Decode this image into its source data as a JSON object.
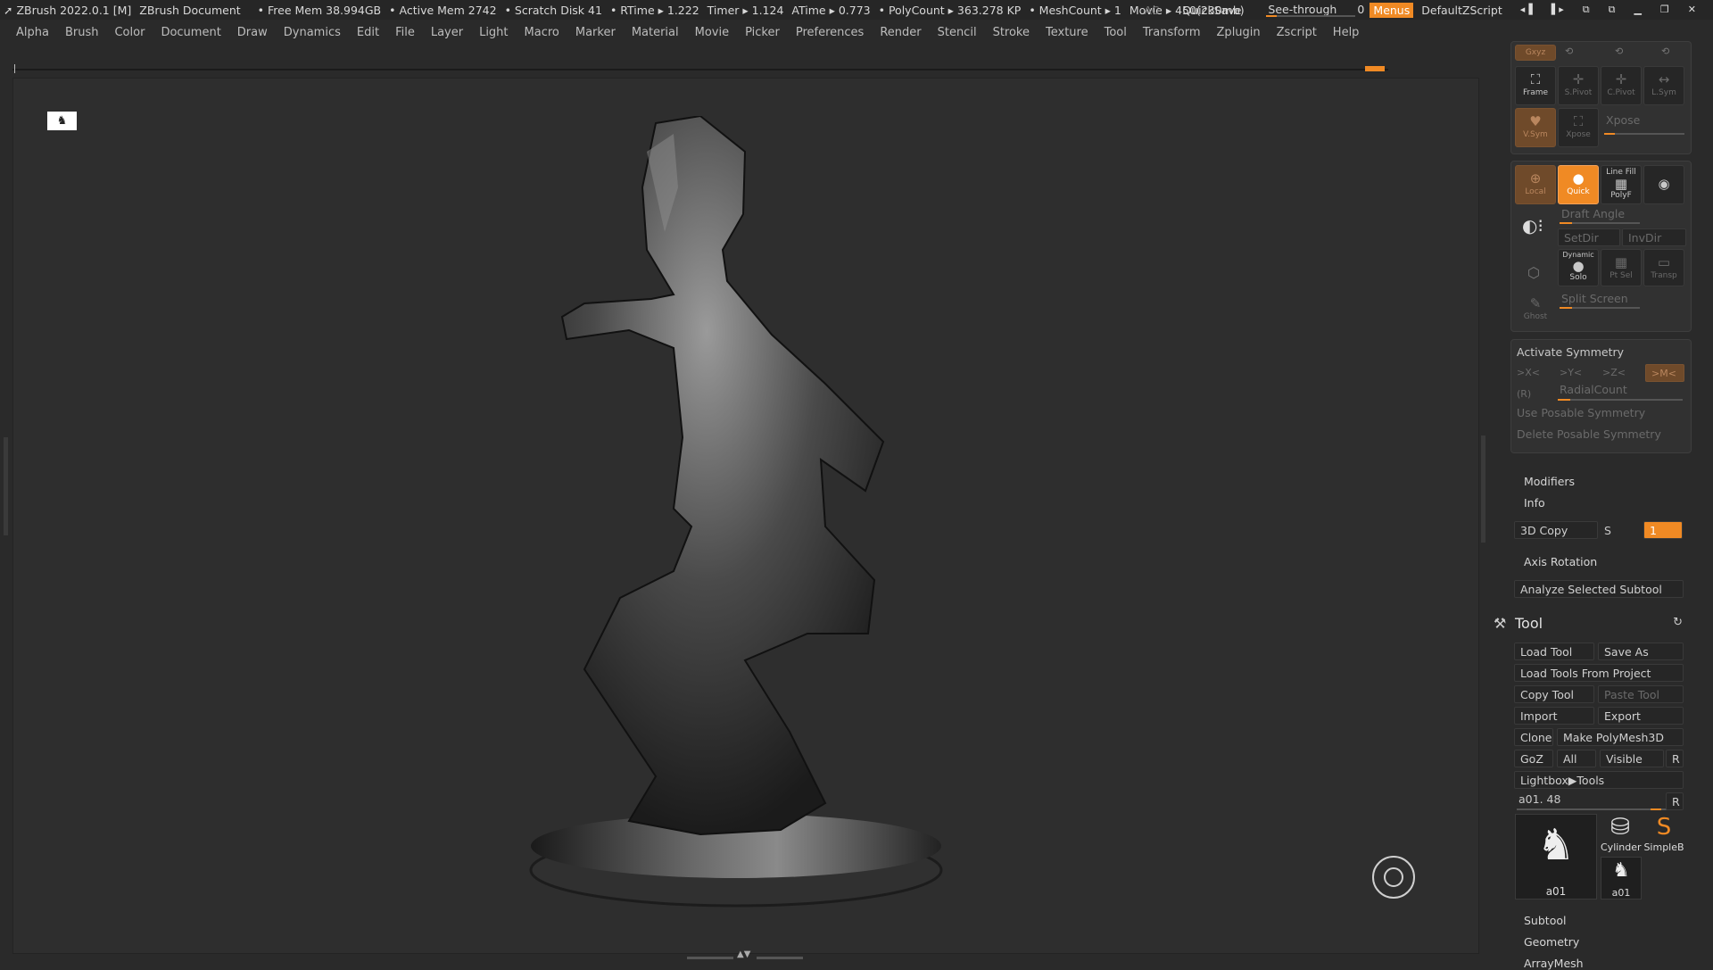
{
  "titlebar": {
    "app": "ZBrush 2022.0.1 [M]",
    "doc": "ZBrush Document",
    "free_mem": "• Free Mem 38.994GB",
    "active_mem": "• Active Mem 2742",
    "scratch": "• Scratch Disk 41",
    "rtime": "• RTime ▸ 1.222",
    "timer": "Timer ▸ 1.124",
    "atime": "ATime ▸ 0.773",
    "polycount": "• PolyCount ▸ 363.278 KP",
    "meshcount": "• MeshCount ▸ 1",
    "movie": "Movie ▸ 450(230mb)",
    "ac": "AC",
    "quicksave": "QuickSave",
    "see_through_label": "See-through",
    "see_through_value": "0",
    "menus": "Menus",
    "script": "DefaultZScript"
  },
  "menubar": [
    "Alpha",
    "Brush",
    "Color",
    "Document",
    "Draw",
    "Dynamics",
    "Edit",
    "File",
    "Layer",
    "Light",
    "Macro",
    "Marker",
    "Material",
    "Movie",
    "Picker",
    "Preferences",
    "Render",
    "Stencil",
    "Stroke",
    "Texture",
    "Tool",
    "Transform",
    "Zplugin",
    "Zscript",
    "Help"
  ],
  "viewport": {
    "minimap_glyph": "🯅"
  },
  "panel": {
    "xyz": "Gxyz",
    "frame": "Frame",
    "spivot": "S.Pivot",
    "cpivot": "C.Pivot",
    "lsym": "L.Sym",
    "vsym": "V.Sym",
    "xpose_icon": "Xpose",
    "xpose": "Xpose",
    "local": "Local",
    "quick": "Quick",
    "linefill": "Line Fill",
    "polyf": "PolyF",
    "draft_angle": "Draft Angle",
    "setdir": "SetDir",
    "invdir": "InvDir",
    "dynamic": "Dynamic",
    "solo": "Solo",
    "ptsel": "Pt Sel",
    "transp": "Transp",
    "split_screen": "Split Screen",
    "ghost": "Ghost",
    "activate_symmetry": "Activate Symmetry",
    "x": ">X<",
    "y": ">Y<",
    "z": ">Z<",
    "m": ">M<",
    "r": "(R)",
    "radial_count": "RadialCount",
    "use_posable": "Use Posable Symmetry",
    "delete_posable": "Delete Posable Symmetry",
    "modifiers": "Modifiers",
    "info": "Info",
    "copy3d": "3D Copy",
    "s": "S",
    "s_value": "1",
    "axis_rotation": "Axis Rotation",
    "analyze": "Analyze Selected Subtool",
    "tool": "Tool",
    "load_tool": "Load Tool",
    "save_as": "Save As",
    "load_from_project": "Load Tools From Project",
    "copy_tool": "Copy Tool",
    "paste_tool": "Paste Tool",
    "import": "Import",
    "export": "Export",
    "clone": "Clone",
    "make_polymesh": "Make PolyMesh3D",
    "goz": "GoZ",
    "all": "All",
    "visible": "Visible",
    "r_btn": "R",
    "lightbox_tools": "Lightbox▶Tools",
    "current_tool": "a01. 48",
    "r_btn2": "R",
    "thumb_a01": "a01",
    "thumb_cylinder": "Cylinder",
    "thumb_simpleb": "SimpleB",
    "thumb_a01_small": "a01",
    "subtool": "Subtool",
    "geometry": "Geometry",
    "arraymesh": "ArrayMesh"
  },
  "colors": {
    "accent": "#f08a24"
  }
}
